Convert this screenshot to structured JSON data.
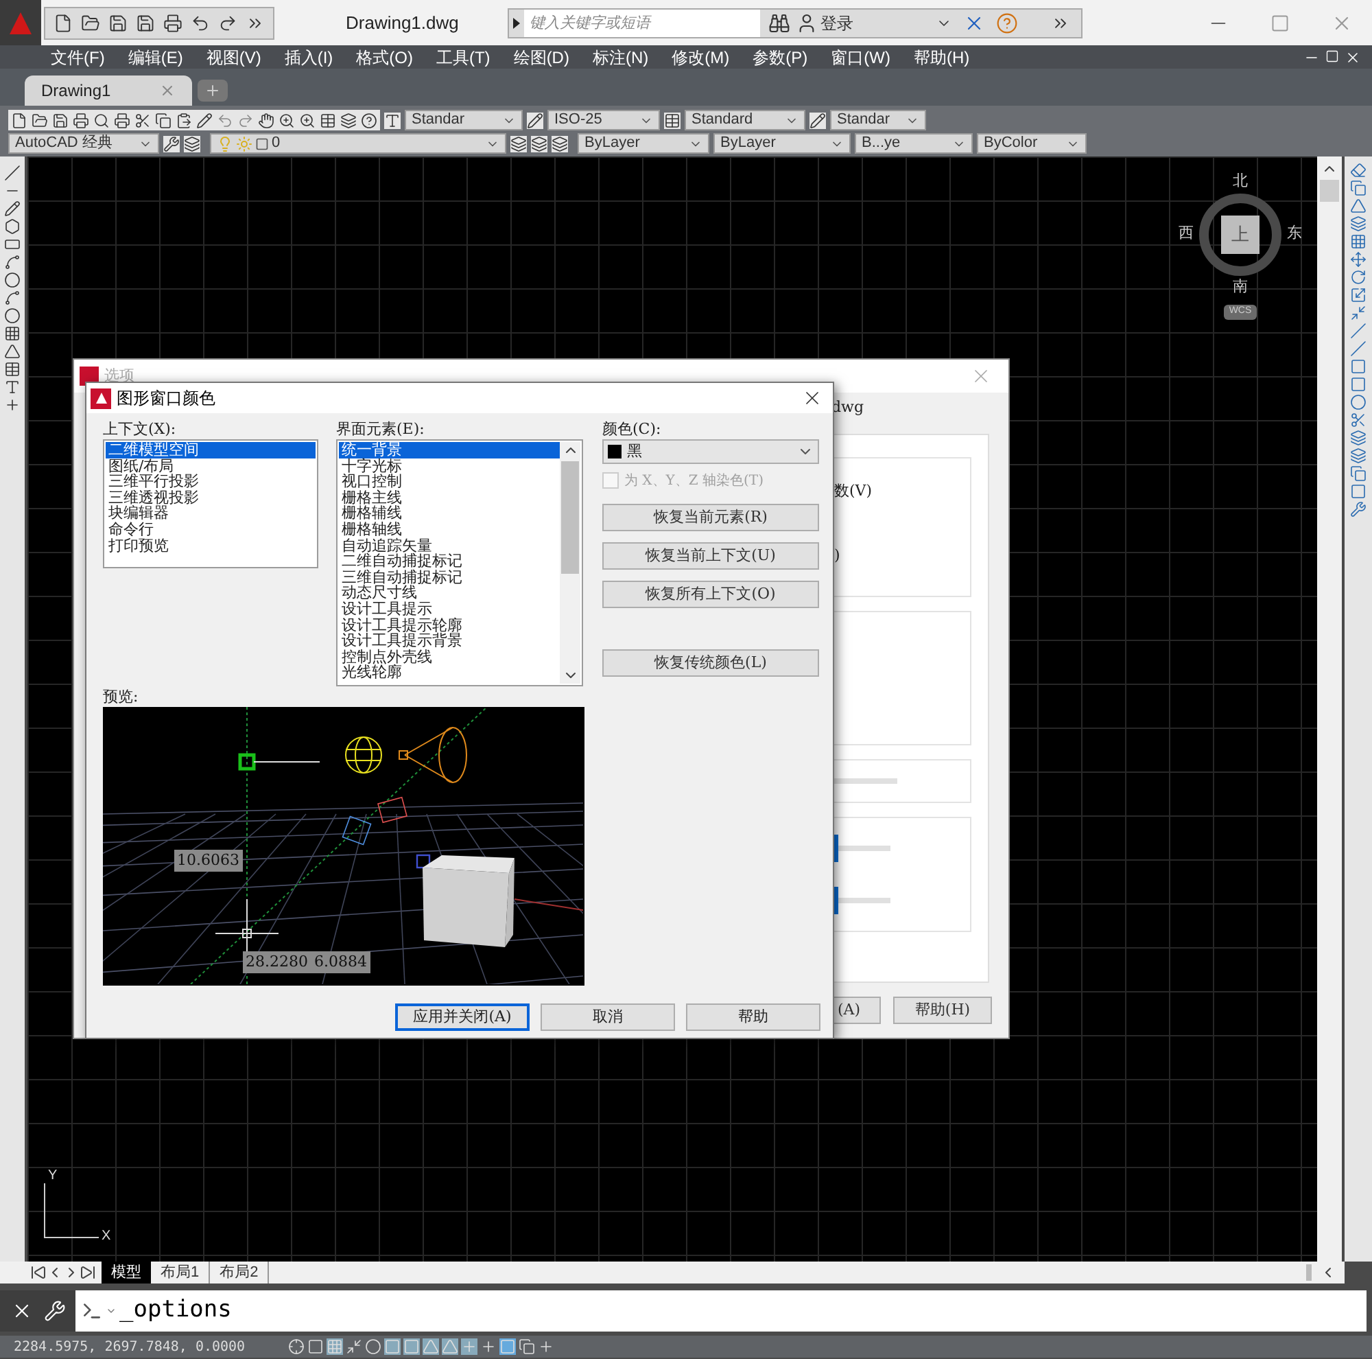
{
  "app_bar": {
    "title": "Drawing1.dwg",
    "search": {
      "placeholder": "键入关键字或短语"
    },
    "login": "登录"
  },
  "menu": [
    "文件(F)",
    "编辑(E)",
    "视图(V)",
    "插入(I)",
    "格式(O)",
    "工具(T)",
    "绘图(D)",
    "标注(N)",
    "修改(M)",
    "参数(P)",
    "窗口(W)",
    "帮助(H)"
  ],
  "doc_tabs": [
    {
      "label": "Drawing1",
      "selected": true
    }
  ],
  "style_dropdowns": [
    "Standar",
    "ISO-25",
    "Standard",
    "Standar"
  ],
  "layer_toolbar": {
    "workspace": "AutoCAD 经典",
    "layer": "0",
    "color_control": "ByLayer",
    "linetype": "ByLayer",
    "lineweight": "B...ye",
    "plot_style": "ByColor"
  },
  "viewcube": {
    "north": "北",
    "west": "西",
    "top": "上",
    "east": "东",
    "south": "南",
    "ucs": "WCS"
  },
  "ucs_icon": {
    "x": "X",
    "y": "Y"
  },
  "options_dialog": {
    "title": "选项",
    "file_label": "dwg",
    "fragments": [
      "数(V)",
      ")"
    ],
    "sliders": [
      {
        "level": 0.6
      },
      {
        "level": 0.6
      }
    ],
    "buttons": [
      "(A)",
      "帮助(H)"
    ]
  },
  "color_dialog": {
    "title": "图形窗口颜色",
    "context_label": "上下文(X):",
    "contexts": [
      {
        "label": "二维模型空间",
        "selected": true
      },
      {
        "label": "图纸/布局",
        "selected": false
      },
      {
        "label": "三维平行投影",
        "selected": false
      },
      {
        "label": "三维透视投影",
        "selected": false
      },
      {
        "label": "块编辑器",
        "selected": false
      },
      {
        "label": "命令行",
        "selected": false
      },
      {
        "label": "打印预览",
        "selected": false
      }
    ],
    "element_label": "界面元素(E):",
    "elements": [
      {
        "label": "统一背景",
        "selected": true
      },
      {
        "label": "十字光标",
        "selected": false
      },
      {
        "label": "视口控制",
        "selected": false
      },
      {
        "label": "栅格主线",
        "selected": false
      },
      {
        "label": "栅格辅线",
        "selected": false
      },
      {
        "label": "栅格轴线",
        "selected": false
      },
      {
        "label": "自动追踪矢量",
        "selected": false
      },
      {
        "label": "二维自动捕捉标记",
        "selected": false
      },
      {
        "label": "三维自动捕捉标记",
        "selected": false
      },
      {
        "label": "动态尺寸线",
        "selected": false
      },
      {
        "label": "设计工具提示",
        "selected": false
      },
      {
        "label": "设计工具提示轮廓",
        "selected": false
      },
      {
        "label": "设计工具提示背景",
        "selected": false
      },
      {
        "label": "控制点外壳线",
        "selected": false
      },
      {
        "label": "光线轮廓",
        "selected": false
      }
    ],
    "color_label": "颜色(C):",
    "color": {
      "value": "黑",
      "color": "#000000"
    },
    "tint_checkbox": {
      "label": "为 X、Y、Z 轴染色(T)",
      "checked": false,
      "disabled": true
    },
    "restore_buttons": [
      "恢复当前元素(R)",
      "恢复当前上下文(U)",
      "恢复所有上下文(O)"
    ],
    "legacy_button": "恢复传统颜色(L)",
    "preview_label": "预览:",
    "preview_values": [
      "10.6063",
      "28.2280",
      "6.0884"
    ],
    "buttons": [
      {
        "label": "应用并关闭(A)",
        "default": true
      },
      {
        "label": "取消",
        "default": false
      },
      {
        "label": "帮助",
        "default": false
      }
    ]
  },
  "layout_tabs": [
    {
      "label": "模型",
      "selected": true
    },
    {
      "label": "布局1",
      "selected": false
    },
    {
      "label": "布局2",
      "selected": false
    }
  ],
  "command_line": {
    "value": "_options"
  },
  "status_bar": {
    "coordinates": "2284.5975, 2697.7848, 0.0000"
  }
}
